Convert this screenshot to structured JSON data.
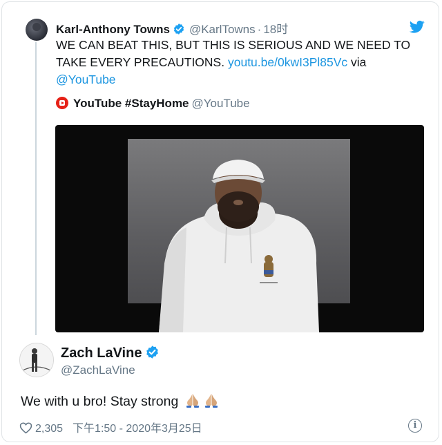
{
  "quoted_tweet": {
    "author_name": "Karl-Anthony Towns",
    "author_handle": "@KarlTowns",
    "separator": "·",
    "time": "18时",
    "text": "WE CAN BEAT THIS, BUT THIS IS SERIOUS AND WE NEED TO TAKE EVERY PRECAUTIONS.",
    "link": "youtu.be/0kwI3Pl85Vc",
    "via": "via",
    "via_handle": "@YouTube",
    "card": {
      "title": "YouTube #StayHome",
      "handle": "@YouTube"
    }
  },
  "reply_tweet": {
    "author_name": "Zach LaVine",
    "author_handle": "@ZachLaVine",
    "text": "We with u bro! Stay strong",
    "emoji": [
      "praying-hands-emoji",
      "praying-hands-emoji"
    ],
    "likes": "2,305",
    "timestamp": "下午1:50 - 2020年3月25日",
    "info_glyph": "i"
  },
  "colors": {
    "link": "#1b95e0",
    "verified": "#1da1f2",
    "secondary_text": "#657786",
    "youtube_red": "#e62117"
  }
}
